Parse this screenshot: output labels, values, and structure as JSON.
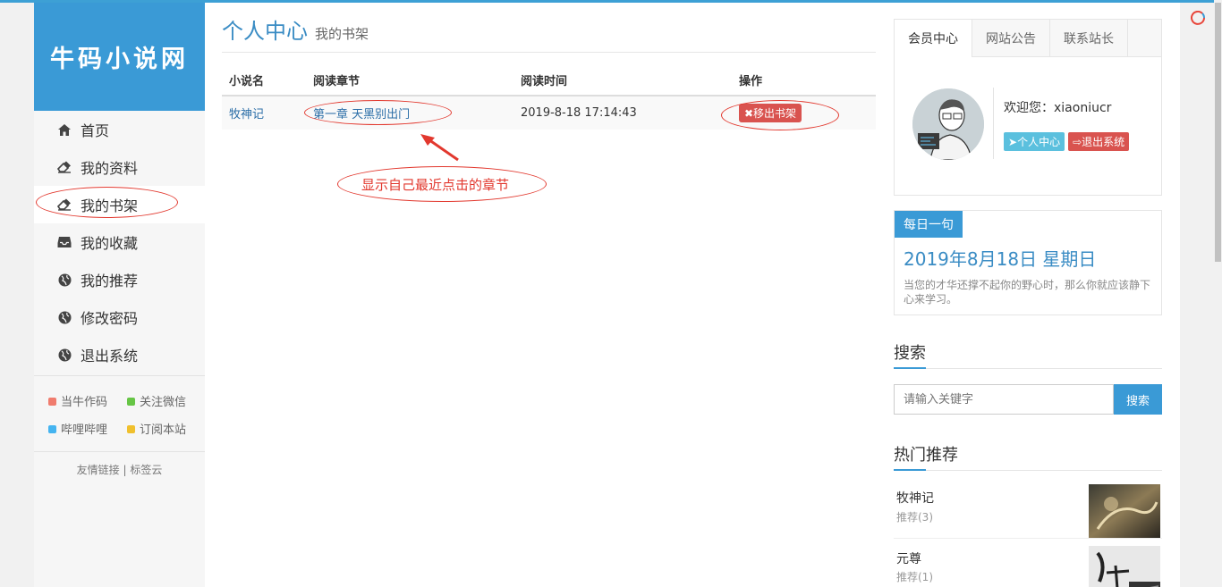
{
  "site": {
    "logo": "牛码小说网"
  },
  "sidebar": {
    "items": [
      {
        "label": "首页",
        "icon": "home-icon"
      },
      {
        "label": "我的资料",
        "icon": "eraser-icon"
      },
      {
        "label": "我的书架",
        "icon": "eraser-icon"
      },
      {
        "label": "我的收藏",
        "icon": "inbox-icon"
      },
      {
        "label": "我的推荐",
        "icon": "globe-icon"
      },
      {
        "label": "修改密码",
        "icon": "globe-icon"
      },
      {
        "label": "退出系统",
        "icon": "globe-icon"
      }
    ],
    "links": [
      {
        "label": "当牛作码",
        "color": "#f07c6e"
      },
      {
        "label": "关注微信",
        "color": "#66c545"
      },
      {
        "label": "哔哩哔哩",
        "color": "#45b4f0"
      },
      {
        "label": "订阅本站",
        "color": "#f0c02d"
      }
    ],
    "footer": "友情链接 | 标签云"
  },
  "main": {
    "title": "个人中心",
    "subtitle": "我的书架",
    "table": {
      "headers": [
        "小说名",
        "阅读章节",
        "阅读时间",
        "操作"
      ],
      "rows": [
        {
          "novel": "牧神记",
          "chapter": "第一章 天黑别出门",
          "time": "2019-8-18 17:14:43",
          "action": "✖移出书架"
        }
      ]
    },
    "annotation": "显示自己最近点击的章节"
  },
  "right": {
    "tabs": [
      "会员中心",
      "网站公告",
      "联系站长"
    ],
    "welcome": "欢迎您：xiaoniucr",
    "btn_center": "个人中心",
    "btn_logout": "退出系统",
    "daily_tag": "每日一句",
    "daily_date": "2019年8月18日 星期日",
    "daily_text": "当您的才华还撑不起你的野心时，那么你就应该静下心来学习。",
    "search_title": "搜索",
    "search_placeholder": "请输入关键字",
    "search_button": "搜索",
    "hot_title": "热门推荐",
    "hot": [
      {
        "name": "元尊",
        "rec": "推荐(1)"
      }
    ],
    "hot_first": {
      "name": "牧神记",
      "rec": "推荐(3)"
    }
  },
  "colors": {
    "accent": "#3a9ad6",
    "danger": "#d9534f",
    "info": "#5bc0de",
    "annotation": "#e2382e"
  }
}
